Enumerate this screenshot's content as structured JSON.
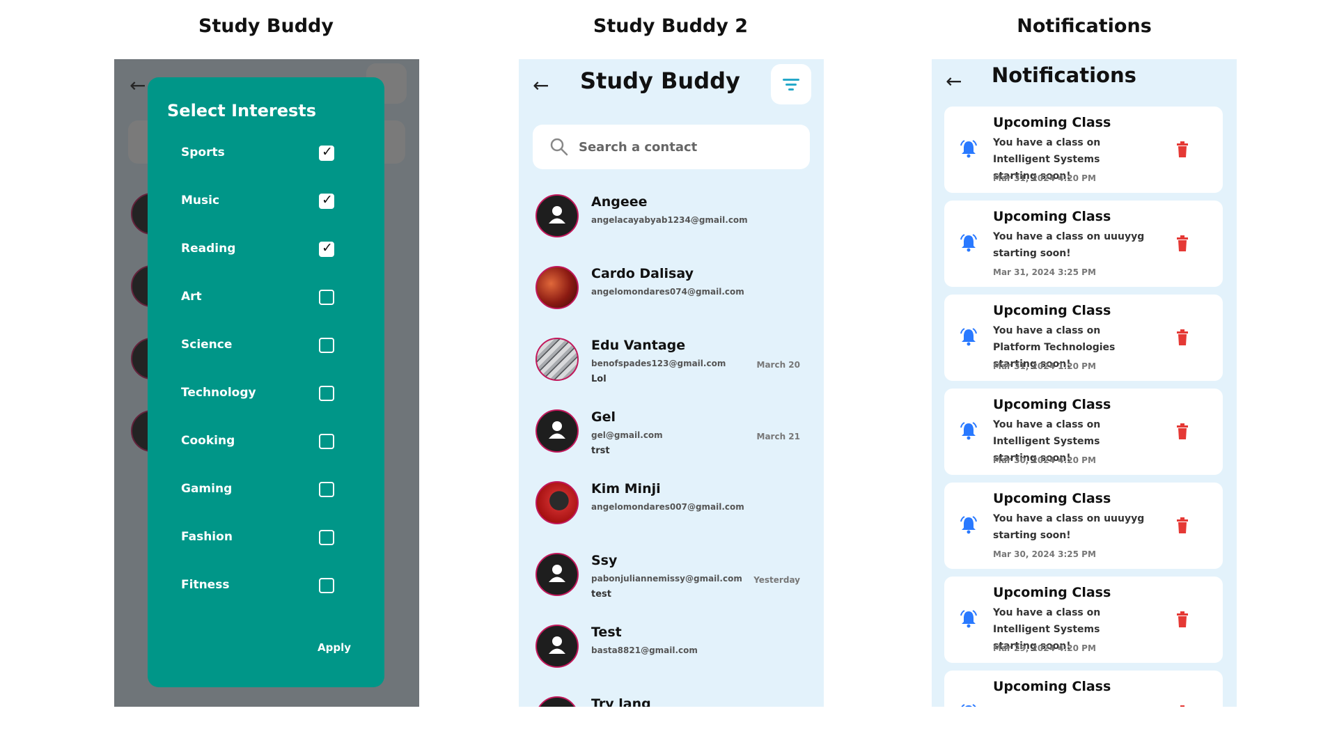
{
  "columns": {
    "left_title": "Study Buddy",
    "middle_title": "Study Buddy 2",
    "right_title": "Notifications"
  },
  "left_panel": {
    "back_icon": "arrow-back-icon",
    "filter_icon": "filter-icon",
    "dialog_title": "Select Interests",
    "options": [
      {
        "label": "Sports",
        "checked": true
      },
      {
        "label": "Music",
        "checked": true
      },
      {
        "label": "Reading",
        "checked": true
      },
      {
        "label": "Art",
        "checked": false
      },
      {
        "label": "Science",
        "checked": false
      },
      {
        "label": "Technology",
        "checked": false
      },
      {
        "label": "Cooking",
        "checked": false
      },
      {
        "label": "Gaming",
        "checked": false
      },
      {
        "label": "Fashion",
        "checked": false
      },
      {
        "label": "Fitness",
        "checked": false
      }
    ],
    "apply_label": "Apply"
  },
  "middle_panel": {
    "title": "Study Buddy",
    "search_placeholder": "Search a contact",
    "contacts": [
      {
        "name": "Angeee",
        "email": "angelacayabyab1234@gmail.com",
        "message": "",
        "date": ""
      },
      {
        "name": "Cardo Dalisay",
        "email": "angelomondares074@gmail.com",
        "message": "",
        "date": ""
      },
      {
        "name": "Edu Vantage",
        "email": "benofspades123@gmail.com",
        "message": "Lol",
        "date": "March 20"
      },
      {
        "name": "Gel",
        "email": "gel@gmail.com",
        "message": "trst",
        "date": "March 21"
      },
      {
        "name": "Kim Minji",
        "email": "angelomondares007@gmail.com",
        "message": "",
        "date": ""
      },
      {
        "name": "Ssy",
        "email": "pabonjuliannemissy@gmail.com",
        "message": "test",
        "date": "Yesterday"
      },
      {
        "name": "Test",
        "email": "basta8821@gmail.com",
        "message": "",
        "date": ""
      },
      {
        "name": "Try lang",
        "email": "",
        "message": "",
        "date": ""
      }
    ]
  },
  "right_panel": {
    "title": "Notifications",
    "notifications": [
      {
        "title": "Upcoming Class",
        "message": "You have a class on Intelligent Systems starting soon!",
        "time": "Mar 31, 2024 4:20 PM"
      },
      {
        "title": "Upcoming Class",
        "message": "You have a class on uuuyyg starting soon!",
        "time": "Mar 31, 2024 3:25 PM"
      },
      {
        "title": "Upcoming Class",
        "message": "You have a class on Platform Technologies starting soon!",
        "time": "Mar 31, 2024 1:20 PM"
      },
      {
        "title": "Upcoming Class",
        "message": "You have a class on Intelligent Systems starting soon!",
        "time": "Mar 30, 2024 4:20 PM"
      },
      {
        "title": "Upcoming Class",
        "message": "You have a class on uuuyyg starting soon!",
        "time": "Mar 30, 2024 3:25 PM"
      },
      {
        "title": "Upcoming Class",
        "message": "You have a class on Intelligent Systems starting soon!",
        "time": "Mar 29, 2024 4:20 PM"
      },
      {
        "title": "Upcoming Class",
        "message": "",
        "time": ""
      }
    ]
  },
  "colors": {
    "screen_bg": "#e3f2fb",
    "dialog_bg": "#009688",
    "filter_accent": "#26a8c9",
    "bell_blue": "#2979ff",
    "delete_red": "#e53935",
    "avatar_border": "#c2185b"
  }
}
